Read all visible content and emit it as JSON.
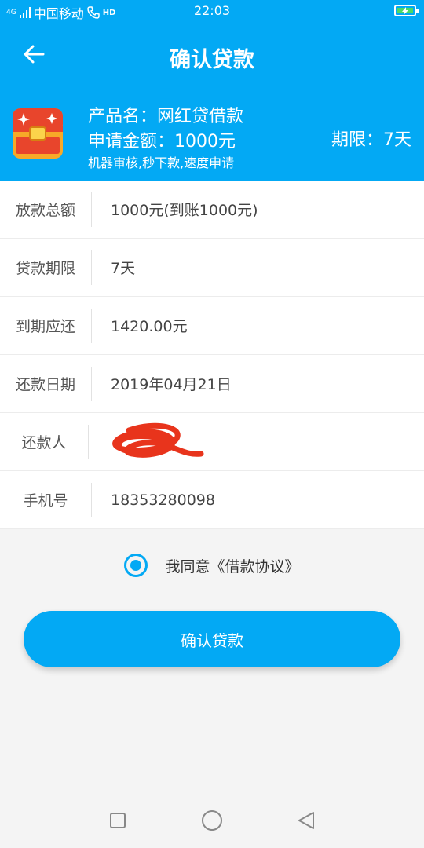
{
  "status_bar": {
    "network": "4G",
    "carrier": "中国移动",
    "hd": "HD",
    "time": "22:03"
  },
  "header": {
    "title": "确认贷款"
  },
  "product": {
    "name": "产品名：网红贷借款",
    "amount": "申请金额：1000元",
    "description": "机器审核,秒下款,速度申请",
    "term": "期限：7天"
  },
  "details": [
    {
      "label": "放款总额",
      "value": "1000元(到账1000元)"
    },
    {
      "label": "贷款期限",
      "value": "7天"
    },
    {
      "label": "到期应还",
      "value": "1420.00元"
    },
    {
      "label": "还款日期",
      "value": "2019年04月21日"
    },
    {
      "label": "还款人",
      "value": ""
    },
    {
      "label": "手机号",
      "value": "18353280098"
    }
  ],
  "agreement": {
    "text": "我同意《借款协议》",
    "checked": true
  },
  "confirm_button": {
    "label": "确认贷款"
  },
  "colors": {
    "primary": "#03a9f4",
    "scribble": "#e8341c"
  },
  "icons": {
    "back": "arrow-left-icon",
    "product": "treasure-chest-icon",
    "nav": [
      "square-recents-icon",
      "circle-home-icon",
      "triangle-back-icon"
    ]
  }
}
